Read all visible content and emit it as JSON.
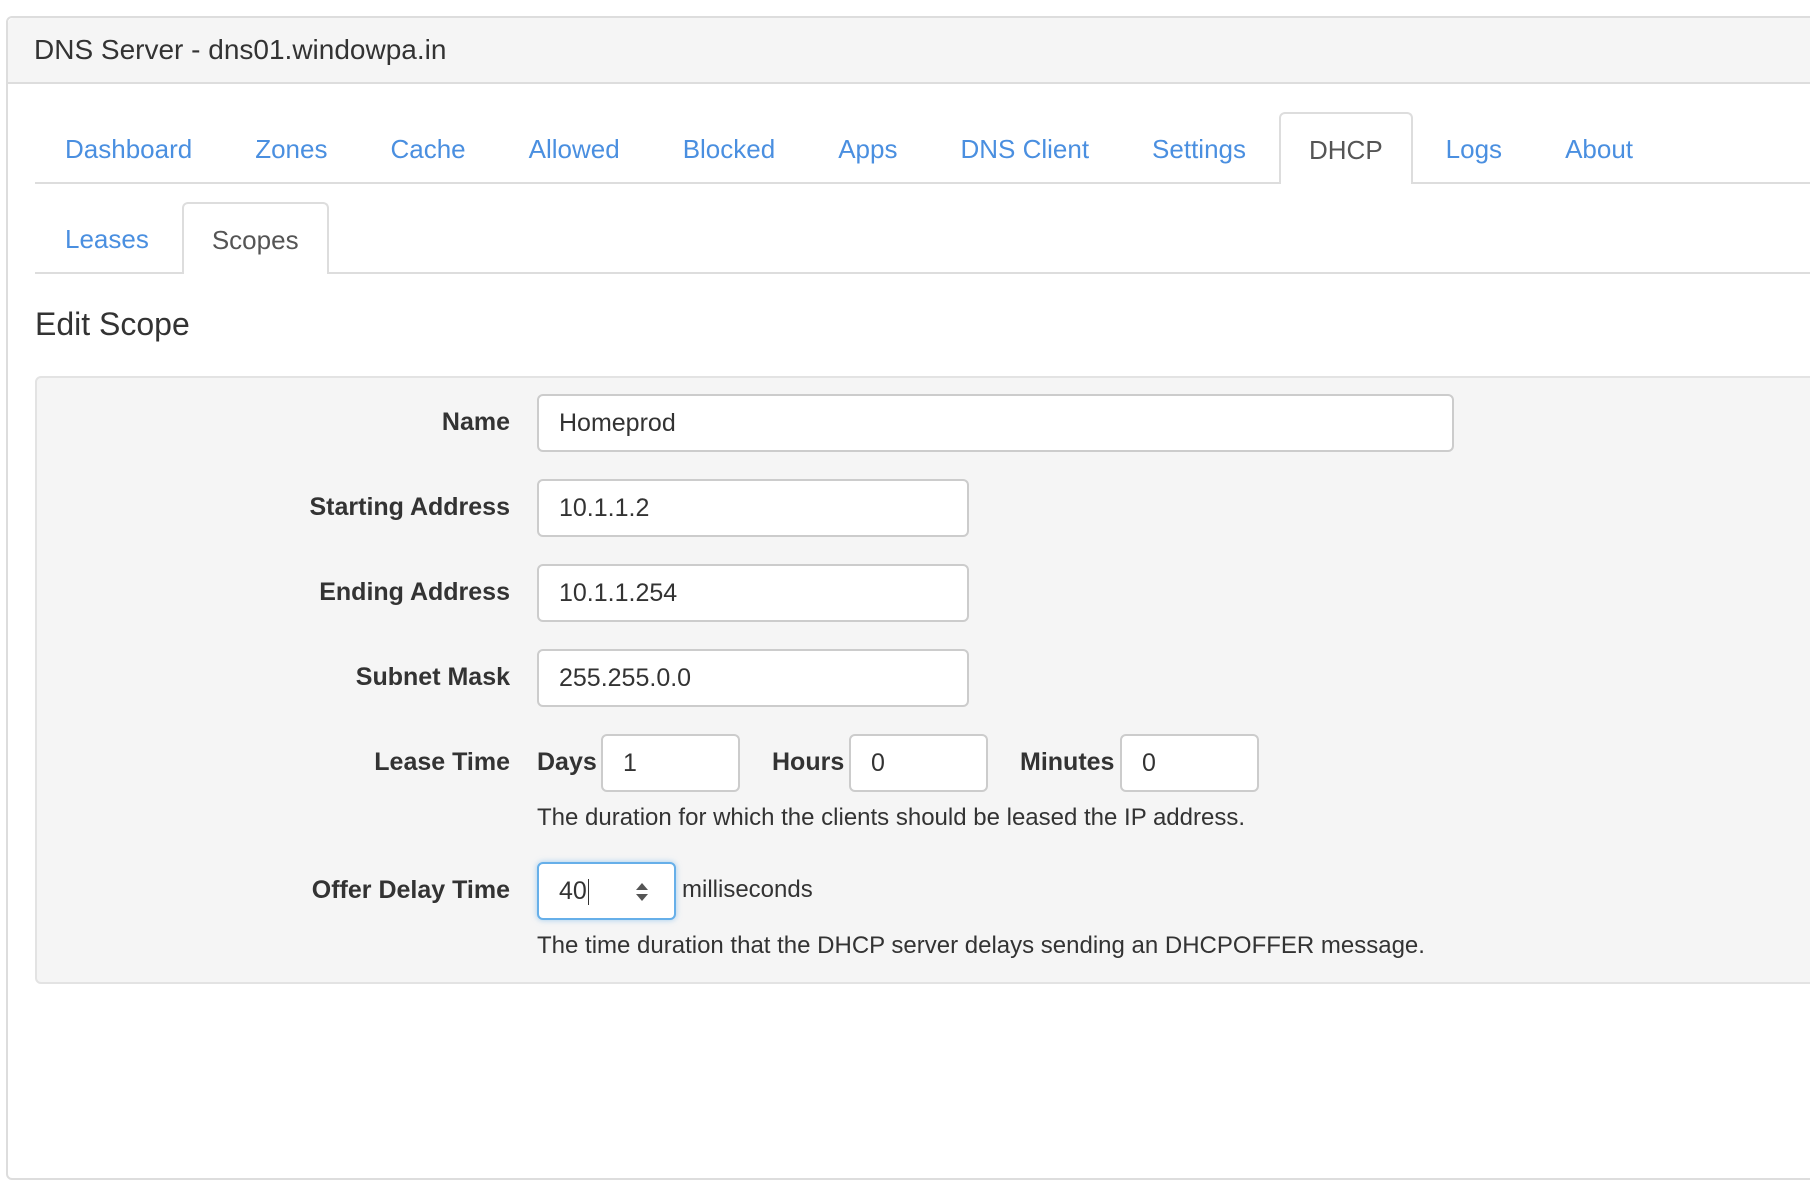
{
  "window": {
    "title": "DNS Server - dns01.windowpa.in"
  },
  "main_tabs": [
    {
      "label": "Dashboard",
      "active": false
    },
    {
      "label": "Zones",
      "active": false
    },
    {
      "label": "Cache",
      "active": false
    },
    {
      "label": "Allowed",
      "active": false
    },
    {
      "label": "Blocked",
      "active": false
    },
    {
      "label": "Apps",
      "active": false
    },
    {
      "label": "DNS Client",
      "active": false
    },
    {
      "label": "Settings",
      "active": false
    },
    {
      "label": "DHCP",
      "active": true
    },
    {
      "label": "Logs",
      "active": false
    },
    {
      "label": "About",
      "active": false
    }
  ],
  "sub_tabs": [
    {
      "label": "Leases",
      "active": false
    },
    {
      "label": "Scopes",
      "active": true
    }
  ],
  "form": {
    "title": "Edit Scope",
    "name": {
      "label": "Name",
      "value": "Homeprod"
    },
    "starting_address": {
      "label": "Starting Address",
      "value": "10.1.1.2"
    },
    "ending_address": {
      "label": "Ending Address",
      "value": "10.1.1.254"
    },
    "subnet_mask": {
      "label": "Subnet Mask",
      "value": "255.255.0.0"
    },
    "lease_time": {
      "label": "Lease Time",
      "days_label": "Days",
      "days_value": "1",
      "hours_label": "Hours",
      "hours_value": "0",
      "minutes_label": "Minutes",
      "minutes_value": "0",
      "help": "The duration for which the clients should be leased the IP address."
    },
    "offer_delay": {
      "label": "Offer Delay Time",
      "value": "40",
      "unit": "milliseconds",
      "help": "The time duration that the DHCP server delays sending an DHCPOFFER message."
    }
  },
  "colors": {
    "link": "#4a8fe0",
    "active_tab_text": "#555555",
    "well_bg": "#f5f5f5",
    "focus_border": "#66afe9"
  },
  "icons": {
    "offer_delay_spinner": "number-spinner-icon"
  }
}
